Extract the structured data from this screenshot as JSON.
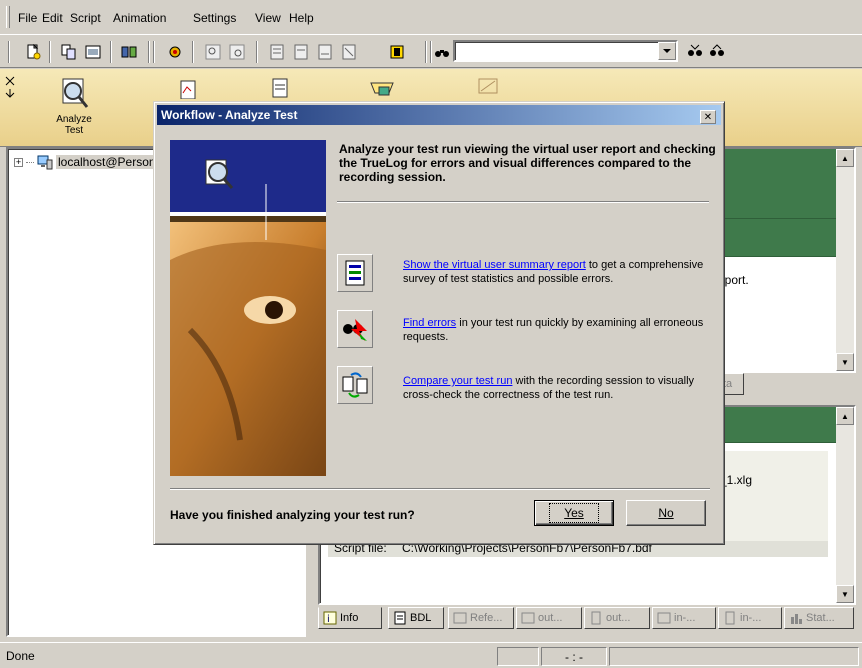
{
  "menu": [
    {
      "label": "File"
    },
    {
      "label": "Edit"
    },
    {
      "label": "Script"
    },
    {
      "label": "Animation"
    },
    {
      "label": "Settings"
    },
    {
      "label": "View"
    },
    {
      "label": "Help"
    }
  ],
  "search": {
    "value": ""
  },
  "workflow": {
    "analyze_label_line1": "Analyze",
    "analyze_label_line2": "Test"
  },
  "tree": {
    "root_label": "localhost@Person"
  },
  "right_top": {
    "report_fragment": "eport.",
    "tab_fragment": "ta"
  },
  "right_bottom": {
    "file_fragment": "_1.xlg",
    "script_row_label": "Script file:",
    "script_row_value": "C:\\Working\\Projects\\PersonFb7\\PersonFb7.bdf"
  },
  "tabs": [
    {
      "label": "Info",
      "icon": "info-icon"
    },
    {
      "label": "BDL",
      "icon": "bdl-icon"
    },
    {
      "label": "Refe...",
      "icon": "reference-icon"
    },
    {
      "label": "out...",
      "icon": "out-icon"
    },
    {
      "label": "out...",
      "icon": "out-icon"
    },
    {
      "label": "in-...",
      "icon": "in-icon"
    },
    {
      "label": "in-...",
      "icon": "in-icon"
    },
    {
      "label": "Stat...",
      "icon": "stat-icon"
    }
  ],
  "status": {
    "text": "Done",
    "position": "- : -"
  },
  "dialog": {
    "title": "Workflow - Analyze Test",
    "heading": "Analyze your test run viewing the virtual user report and checking the TrueLog for errors and visual differences compared to the recording session.",
    "actions": [
      {
        "link": "Show the virtual user summary report",
        "text": " to get a comprehensive survey of test statistics and possible errors."
      },
      {
        "link": "Find errors",
        "text": " in your test run quickly by examining all erroneous requests."
      },
      {
        "link": "Compare your test run",
        "text": " with the recording session to visually cross-check the correctness of the test run."
      }
    ],
    "question": "Have you finished analyzing your test run?",
    "yes_label": "Yes",
    "no_label": "No"
  },
  "colors": {
    "title_start": "#0a246a",
    "title_end": "#a6caf0",
    "link": "#0000ff",
    "panel_green": "#3f7a4b",
    "chrome": "#d4d0c8"
  }
}
